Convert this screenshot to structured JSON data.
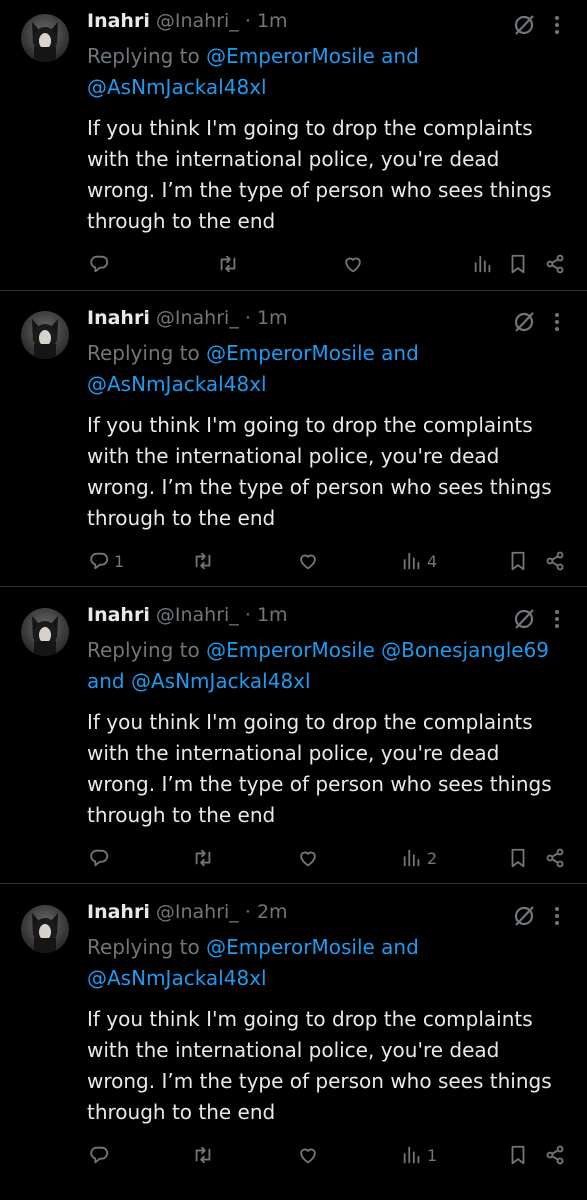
{
  "tweets": [
    {
      "name": "Inahri",
      "handle": "@Inahri_",
      "dot": "·",
      "time": "1m",
      "reply_prefix": "Replying to",
      "reply_line1_mentions": "@EmperorMosile and",
      "reply_line2_mentions": "@AsNmJackal48xl",
      "text_lines": [
        "If you think I'm going to drop the complaints",
        "with the international police, you're dead",
        "wrong. I’m the type of person who sees things",
        "through to the end"
      ],
      "reply_count": "",
      "retweet_count": "",
      "like_count": "",
      "views_count": ""
    },
    {
      "name": "Inahri",
      "handle": "@Inahri_",
      "dot": "·",
      "time": "1m",
      "reply_prefix": "Replying to",
      "reply_line1_mentions": "@EmperorMosile and",
      "reply_line2_mentions": "@AsNmJackal48xl",
      "text_lines": [
        "If you think I'm going to drop the complaints",
        "with the international police, you're dead",
        "wrong. I’m the type of person who sees things",
        "through to the end"
      ],
      "reply_count": "1",
      "retweet_count": "",
      "like_count": "",
      "views_count": "4"
    },
    {
      "name": "Inahri",
      "handle": "@Inahri_",
      "dot": "·",
      "time": "1m",
      "reply_prefix": "Replying to",
      "reply_line1_mentions": "@EmperorMosile @Bonesjangle69",
      "reply_line2_mentions": "and @AsNmJackal48xl",
      "text_lines": [
        "If you think I'm going to drop the complaints",
        "with the international police, you're dead",
        "wrong. I’m the type of person who sees things",
        "through to the end"
      ],
      "reply_count": "",
      "retweet_count": "",
      "like_count": "",
      "views_count": "2"
    },
    {
      "name": "Inahri",
      "handle": "@Inahri_",
      "dot": "·",
      "time": "2m",
      "reply_prefix": "Replying to",
      "reply_line1_mentions": "@EmperorMosile and",
      "reply_line2_mentions": "@AsNmJackal48xl",
      "text_lines": [
        "If you think I'm going to drop the complaints",
        "with the international police, you're dead",
        "wrong. I’m the type of person who sees things",
        "through to the end"
      ],
      "reply_count": "",
      "retweet_count": "",
      "like_count": "",
      "views_count": "1"
    }
  ],
  "icons": {
    "avatar": "profile-photo",
    "grok": "grok-icon",
    "more": "more-icon",
    "reply": "reply-icon",
    "retweet": "retweet-icon",
    "like": "like-icon",
    "views": "views-icon",
    "bookmark": "bookmark-icon",
    "share": "share-icon"
  },
  "colors": {
    "background": "#000000",
    "text": "#e7e9ea",
    "secondary": "#71767b",
    "mention": "#1d9bf0",
    "divider": "#2f3336"
  }
}
